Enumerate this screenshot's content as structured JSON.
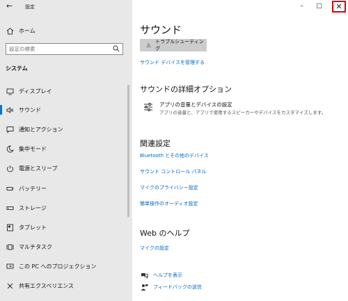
{
  "window": {
    "title": "設定",
    "minimize_glyph": "–",
    "maximize_glyph": "□",
    "close_glyph": "✕",
    "close_highlight_color": "#e00000"
  },
  "sidebar": {
    "home_label": "ホーム",
    "search_placeholder": "設定の検索",
    "section_heading": "システム",
    "items": [
      {
        "label": "ディスプレイ",
        "icon": "display-icon"
      },
      {
        "label": "サウンド",
        "icon": "speaker-icon",
        "active": true
      },
      {
        "label": "通知とアクション",
        "icon": "notification-icon"
      },
      {
        "label": "集中モード",
        "icon": "moon-icon"
      },
      {
        "label": "電源とスリープ",
        "icon": "power-icon"
      },
      {
        "label": "バッテリー",
        "icon": "battery-icon"
      },
      {
        "label": "ストレージ",
        "icon": "storage-icon"
      },
      {
        "label": "タブレット",
        "icon": "tablet-icon"
      },
      {
        "label": "マルチタスク",
        "icon": "multitask-icon"
      },
      {
        "label": "この PC へのプロジェクション",
        "icon": "projection-icon"
      },
      {
        "label": "共有エクスペリエンス",
        "icon": "shared-icon"
      }
    ]
  },
  "main": {
    "title": "サウンド",
    "troubleshoot_label": "トラブルシューティング",
    "manage_devices_link": "サウンド デバイスを管理する",
    "advanced_heading": "サウンドの詳細オプション",
    "app_volume_title": "アプリの音量とデバイスの設定",
    "app_volume_desc": "アプリの音量と、アプリで使用するスピーカーやデバイスをカスタマイズします。",
    "related_heading": "関連設定",
    "related_links": [
      "Bluetooth とその他のデバイス",
      "サウンド コントロール パネル",
      "マイクのプライバシー設定",
      "簡単操作のオーディオ設定"
    ],
    "web_help_heading": "Web のヘルプ",
    "web_help_link": "マイクの設定",
    "help_label": "ヘルプを表示",
    "feedback_label": "フィードバックの送信"
  },
  "colors": {
    "accent": "#0078d7",
    "link": "#0067c0",
    "sidebar_bg": "#e8e8e8"
  }
}
